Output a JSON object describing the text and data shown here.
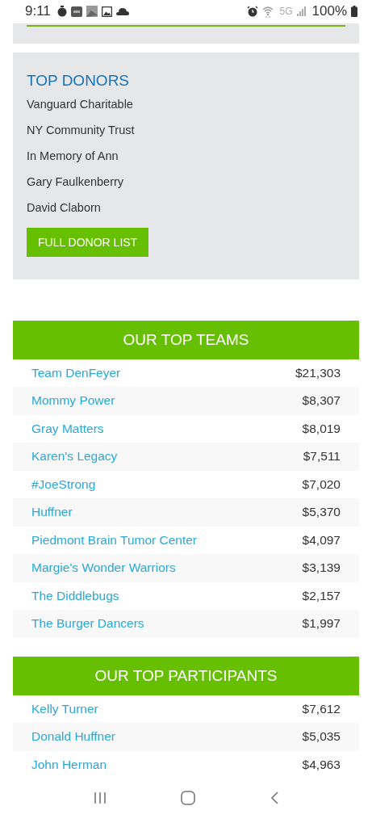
{
  "status_bar": {
    "time": "9:11",
    "network": "5G",
    "battery": "100%"
  },
  "top_donors": {
    "title": "TOP DONORS",
    "donors": [
      "Vanguard Charitable",
      "NY Community Trust",
      "In Memory of Ann",
      "Gary Faulkenberry",
      "David Claborn"
    ],
    "button": "FULL DONOR LIST"
  },
  "top_teams": {
    "title": "OUR TOP TEAMS",
    "rows": [
      {
        "name": "Team DenFeyer",
        "amount": "$21,303"
      },
      {
        "name": "Mommy Power",
        "amount": "$8,307"
      },
      {
        "name": "Gray Matters",
        "amount": "$8,019"
      },
      {
        "name": "Karen's Legacy",
        "amount": "$7,511"
      },
      {
        "name": "#JoeStrong",
        "amount": "$7,020"
      },
      {
        "name": "Huffner",
        "amount": "$5,370"
      },
      {
        "name": "Piedmont Brain Tumor Center",
        "amount": "$4,097"
      },
      {
        "name": "Margie's Wonder Warriors",
        "amount": "$3,139"
      },
      {
        "name": "The Diddlebugs",
        "amount": "$2,157"
      },
      {
        "name": "The Burger Dancers",
        "amount": "$1,997"
      }
    ]
  },
  "top_participants": {
    "title": "OUR TOP PARTICIPANTS",
    "rows": [
      {
        "name": "Kelly Turner",
        "amount": "$7,612"
      },
      {
        "name": "Donald Huffner",
        "amount": "$5,035"
      },
      {
        "name": "John Herman",
        "amount": "$4,963"
      }
    ]
  }
}
